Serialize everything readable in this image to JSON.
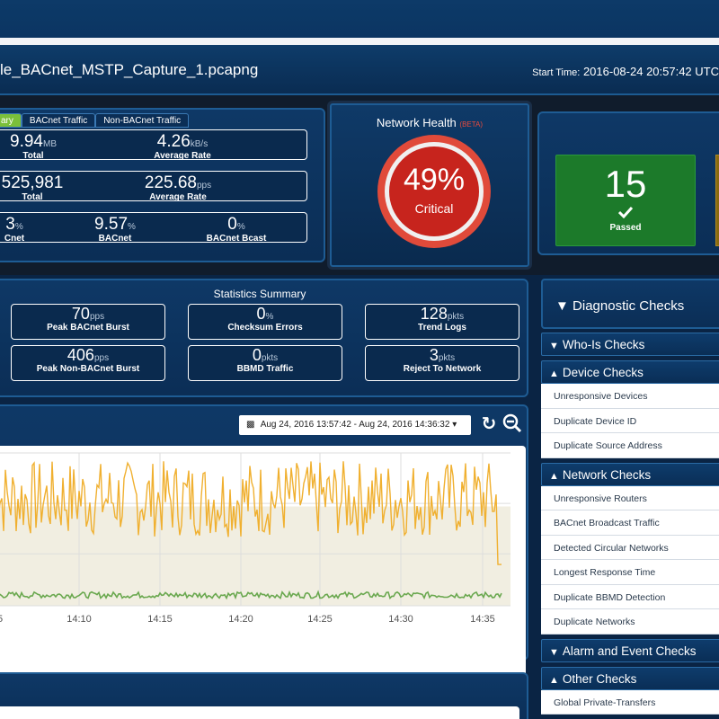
{
  "header": {
    "file_title": "le_BACnet_MSTP_Capture_1.pcapng",
    "start_time_label": "Start Time:",
    "start_time_value": "2016-08-24 20:57:42 UTC"
  },
  "summary_tabs": [
    {
      "label": "ary",
      "active": true
    },
    {
      "label": "BACnet Traffic",
      "active": false
    },
    {
      "label": "Non-BACnet Traffic",
      "active": false
    }
  ],
  "traffic_stats": {
    "row1": [
      {
        "value": "9.94",
        "unit": "MB",
        "caption": "Total"
      },
      {
        "value": "4.26",
        "unit": "kB/s",
        "caption": "Average Rate"
      }
    ],
    "row2": [
      {
        "value": "525,981",
        "unit": "",
        "caption": "Total"
      },
      {
        "value": "225.68",
        "unit": "pps",
        "caption": "Average Rate"
      }
    ],
    "row3": [
      {
        "value": "3",
        "unit": "%",
        "caption": "Cnet"
      },
      {
        "value": "9.57",
        "unit": "%",
        "caption": "BACnet"
      },
      {
        "value": "0",
        "unit": "%",
        "caption": "BACnet Bcast"
      }
    ]
  },
  "network_health": {
    "title": "Network Health",
    "beta": "(BETA)",
    "percent": "49%",
    "status": "Critical",
    "colors": {
      "ring": "#e04a3a",
      "core": "#c7241d"
    }
  },
  "check_results": {
    "passed_count": "15",
    "passed_label": "Passed",
    "passed_color": "#1c7a2a",
    "warning_color": "#8a6a10"
  },
  "statistics_summary": {
    "title": "Statistics Summary",
    "boxes": [
      {
        "value": "70",
        "unit": "pps",
        "caption": "Peak BACnet Burst"
      },
      {
        "value": "0",
        "unit": "%",
        "caption": "Checksum Errors"
      },
      {
        "value": "128",
        "unit": "pkts",
        "caption": "Trend Logs"
      },
      {
        "value": "406",
        "unit": "pps",
        "caption": "Peak Non-BACnet Burst"
      },
      {
        "value": "0",
        "unit": "pkts",
        "caption": "BBMD Traffic"
      },
      {
        "value": "3",
        "unit": "pkts",
        "caption": "Reject To Network"
      }
    ]
  },
  "traffic_chart": {
    "date_range": "Aug 24, 2016 13:57:42 - Aug 24, 2016 14:36:32",
    "refresh_icon": "refresh-icon",
    "zoom_out_icon": "zoom-out-icon"
  },
  "chart_data": {
    "type": "line",
    "x_tick_labels": [
      "05",
      "14:10",
      "14:15",
      "14:20",
      "14:25",
      "14:30",
      "14:35"
    ],
    "series": [
      {
        "color": "#f0b030",
        "level_range": [
          0.45,
          0.95
        ]
      },
      {
        "color": "#6aa84f",
        "level_range": [
          0.05,
          0.09
        ]
      }
    ],
    "grid": true
  },
  "diagnostics": {
    "title": "Diagnostic Checks",
    "sections": [
      {
        "label": "Who-Is Checks",
        "items": []
      },
      {
        "label": "Device Checks",
        "items": [
          "Unresponsive Devices",
          "Duplicate Device ID",
          "Duplicate Source Address"
        ]
      },
      {
        "label": "Network Checks",
        "items": [
          "Unresponsive Routers",
          "BACnet Broadcast Traffic",
          "Detected Circular Networks",
          "Longest Response Time",
          "Duplicate BBMD Detection",
          "Duplicate Networks"
        ]
      },
      {
        "label": "Alarm and Event Checks",
        "items": []
      },
      {
        "label": "Other Checks",
        "items": [
          "Global Private-Transfers"
        ]
      }
    ]
  }
}
